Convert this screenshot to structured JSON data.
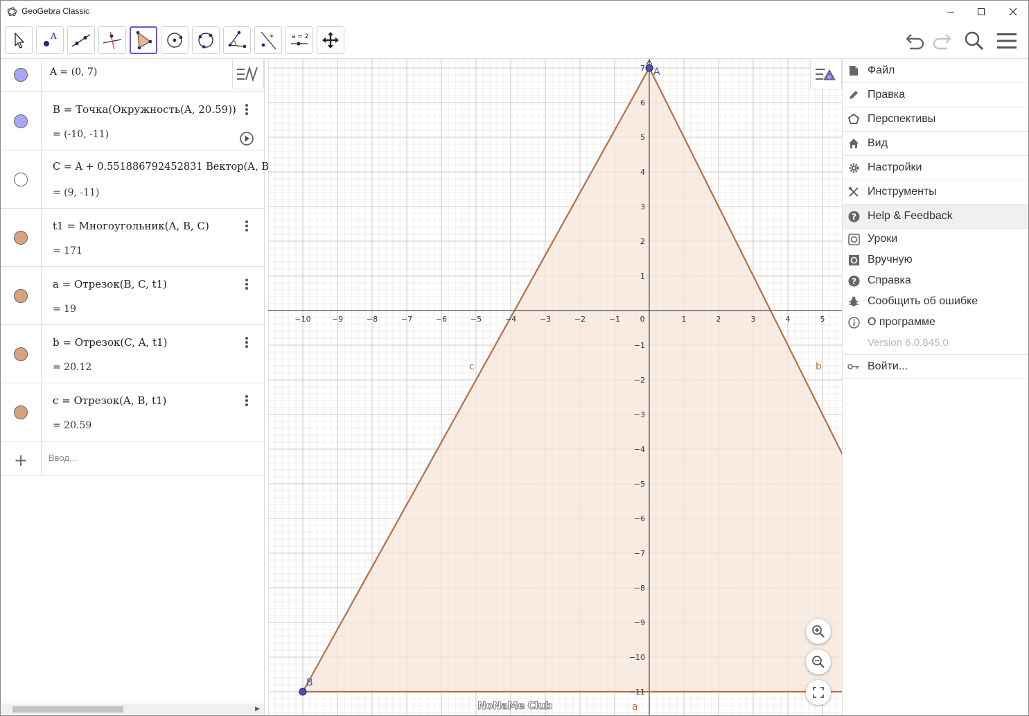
{
  "window": {
    "title": "GeoGebra Classic"
  },
  "toolbar": {
    "tools": [
      "move-tool",
      "point-tool",
      "line-tool",
      "perpendicular-line-tool",
      "polygon-tool",
      "circle-tool",
      "conic-tool",
      "angle-tool",
      "reflect-tool",
      "slider-tool",
      "move-graphics-tool"
    ],
    "active_tool": "polygon-tool",
    "slider_label": "a = 2"
  },
  "algebra": {
    "rows": [
      {
        "name": "A",
        "definition": "A = (0, 7)",
        "value": "",
        "color": "#a7a7f7"
      },
      {
        "name": "B",
        "definition": "B  =  Точка(Окружность(A, 20.59))",
        "value": "=  (-10, -11)",
        "color": "#a7a7f7"
      },
      {
        "name": "C",
        "definition": "C  =  A + 0.551886792452831 Вектор(А, B",
        "value": "=  (9, -11)",
        "color": "#ffffff"
      },
      {
        "name": "t1",
        "definition": "t1  =  Многоугольник(A, B, C)",
        "value": "=  171",
        "color": "#d9a27f"
      },
      {
        "name": "a",
        "definition": "a  =  Отрезок(B, C, t1)",
        "value": "=  19",
        "color": "#d9a27f"
      },
      {
        "name": "b",
        "definition": "b  =  Отрезок(C, A, t1)",
        "value": "=  20.12",
        "color": "#d9a27f"
      },
      {
        "name": "c",
        "definition": "c  =  Отрезок(A, B, t1)",
        "value": "=  20.59",
        "color": "#d9a27f"
      }
    ],
    "input_placeholder": "Ввод..."
  },
  "graphics": {
    "point_labels": {
      "A": "A",
      "B": "B"
    },
    "segment_labels": {
      "a": "a",
      "b": "b",
      "c": "c"
    },
    "x_ticks": [
      "−10",
      "−9",
      "−8",
      "−7",
      "−6",
      "−5",
      "−4",
      "−3",
      "−2",
      "−1",
      "0",
      "1",
      "2",
      "3",
      "4",
      "5"
    ],
    "y_ticks": [
      "7",
      "6",
      "5",
      "4",
      "3",
      "2",
      "1",
      "−1",
      "−2",
      "−3",
      "−4",
      "−5",
      "−6",
      "−7",
      "−8",
      "−9",
      "−10",
      "−11"
    ],
    "watermark": "NoNaMe Club"
  },
  "menu": {
    "items": [
      {
        "label": "Файл",
        "icon": "file-icon"
      },
      {
        "label": "Правка",
        "icon": "pencil-icon"
      },
      {
        "label": "Перспективы",
        "icon": "perspectives-icon"
      },
      {
        "label": "Вид",
        "icon": "home-icon"
      },
      {
        "label": "Настройки",
        "icon": "gear-icon"
      },
      {
        "label": "Инструменты",
        "icon": "tools-icon"
      },
      {
        "label": "Help & Feedback",
        "icon": "help-icon"
      }
    ],
    "help_subitems": [
      {
        "label": "Уроки",
        "icon": "tutorials-icon"
      },
      {
        "label": "Вручную",
        "icon": "manual-icon"
      },
      {
        "label": "Справка",
        "icon": "question-icon"
      },
      {
        "label": "Сообщить об ошибке",
        "icon": "bug-icon"
      },
      {
        "label": "О программе",
        "icon": "info-icon"
      }
    ],
    "version": "Version 6.0.845.0",
    "signin": "Войти..."
  },
  "colors": {
    "accent": "#6557d2",
    "triangle_stroke": "#b2704a",
    "triangle_fill": "#f7e5da",
    "point": "#4d4dcc"
  }
}
